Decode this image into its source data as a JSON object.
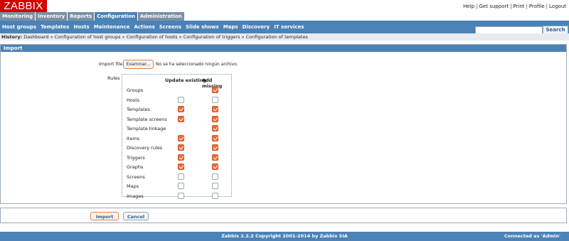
{
  "logo": "ZABBIX",
  "top_links": [
    "Help",
    "Get support",
    "Print",
    "Profile",
    "Logout"
  ],
  "main_menu": [
    "Monitoring",
    "Inventory",
    "Reports",
    "Configuration",
    "Administration"
  ],
  "main_menu_active": "Configuration",
  "sub_menu": [
    "Host groups",
    "Templates",
    "Hosts",
    "Maintenance",
    "Actions",
    "Screens",
    "Slide shows",
    "Maps",
    "Discovery",
    "IT services"
  ],
  "search": {
    "placeholder": "",
    "button": "Search"
  },
  "history": {
    "label": "History:",
    "items": [
      "Dashboard",
      "Configuration of host groups",
      "Configuration of hosts",
      "Configuration of triggers",
      "Configuration of templates"
    ],
    "separator": "»"
  },
  "panel_title": "Import",
  "import_file": {
    "label": "Import file",
    "button": "Examinar...",
    "status": "No se ha seleccionado ningún archivo."
  },
  "rules": {
    "label": "Rules",
    "col_update": "Update existing",
    "col_add": "Add missing",
    "rows": [
      {
        "name": "Groups",
        "update": null,
        "add": true
      },
      {
        "name": "Hosts",
        "update": false,
        "add": false
      },
      {
        "name": "Templates",
        "update": true,
        "add": true
      },
      {
        "name": "Template screens",
        "update": true,
        "add": true
      },
      {
        "name": "Template linkage",
        "update": null,
        "add": true
      },
      {
        "name": "Items",
        "update": true,
        "add": true
      },
      {
        "name": "Discovery rules",
        "update": true,
        "add": true
      },
      {
        "name": "Triggers",
        "update": true,
        "add": true
      },
      {
        "name": "Graphs",
        "update": true,
        "add": true
      },
      {
        "name": "Screens",
        "update": false,
        "add": false
      },
      {
        "name": "Maps",
        "update": false,
        "add": false
      },
      {
        "name": "Images",
        "update": false,
        "add": false
      }
    ]
  },
  "buttons": {
    "import": "Import",
    "cancel": "Cancel"
  },
  "footer": {
    "copyright": "Zabbix 2.2.2 Copyright 2001-2014 by Zabbix SIA",
    "connected": "Connected as 'Admin'"
  },
  "colors": {
    "logo_red": "#d40000",
    "menu_blue": "#4b82b7",
    "check_orange": "#ee6b35"
  }
}
